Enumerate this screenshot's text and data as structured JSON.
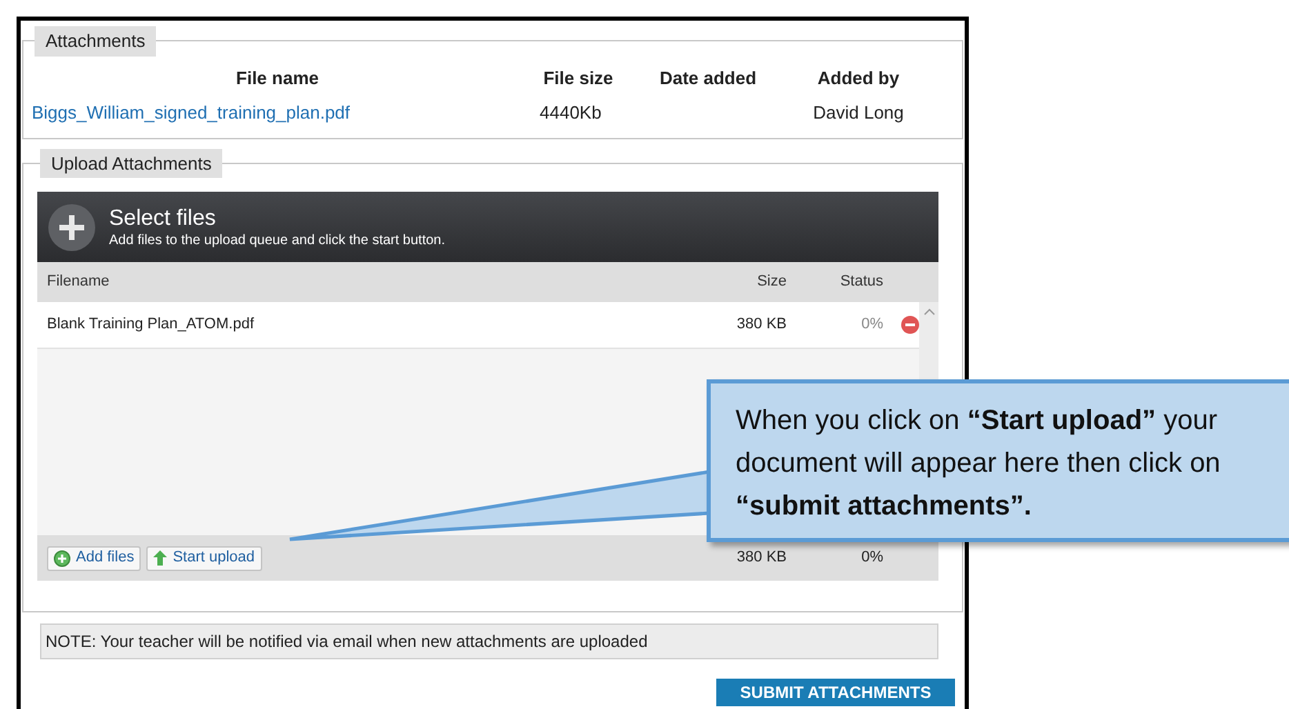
{
  "attachments": {
    "legend": "Attachments",
    "columns": [
      "File name",
      "File size",
      "Date added",
      "Added by"
    ],
    "rows": [
      {
        "file_name": "Biggs_William_signed_training_plan.pdf",
        "file_size": "4440Kb",
        "added_by": "David Long"
      }
    ]
  },
  "upload": {
    "legend": "Upload Attachments",
    "title": "Select files",
    "subtitle": "Add files to the upload queue and click the start button.",
    "columns": [
      "Filename",
      "Size",
      "Status"
    ],
    "queue": [
      {
        "filename": "Blank Training Plan_ATOM.pdf",
        "size": "380 KB",
        "status": "0%"
      }
    ],
    "buttons": [
      {
        "kind": "add",
        "label": "Add files"
      },
      {
        "kind": "start",
        "label": "Start upload"
      }
    ],
    "total_size": "380 KB",
    "total_status": "0%"
  },
  "note": "NOTE: Your teacher will be notified via email when new attachments are uploaded",
  "submit_button": "SUBMIT ATTACHMENTS",
  "callout": "When you click on **“Start upload”** your document will appear here then click on **“submit attachments”.**"
}
